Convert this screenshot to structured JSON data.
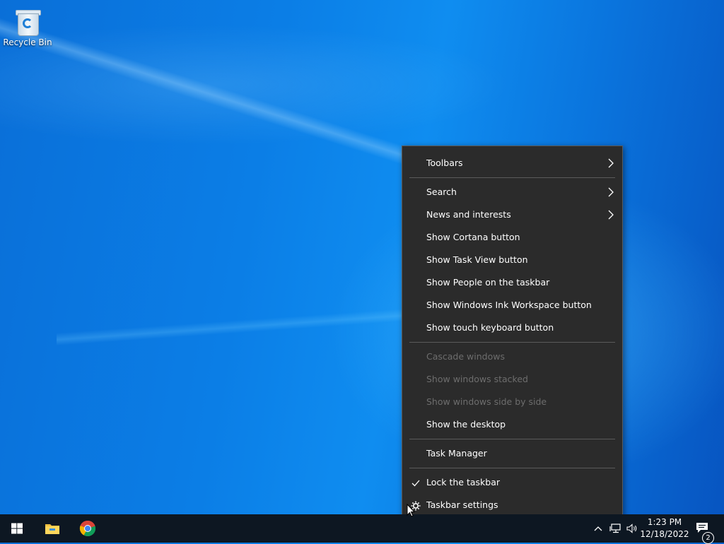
{
  "desktop": {
    "icons": [
      {
        "label": "Recycle Bin",
        "icon": "recycle-bin-icon"
      }
    ]
  },
  "context_menu": {
    "items": [
      {
        "label": "Toolbars",
        "submenu": true,
        "enabled": true
      },
      {
        "label": "Search",
        "submenu": true,
        "enabled": true
      },
      {
        "label": "News and interests",
        "submenu": true,
        "enabled": true
      },
      {
        "label": "Show Cortana button",
        "enabled": true
      },
      {
        "label": "Show Task View button",
        "enabled": true
      },
      {
        "label": "Show People on the taskbar",
        "enabled": true
      },
      {
        "label": "Show Windows Ink Workspace button",
        "enabled": true
      },
      {
        "label": "Show touch keyboard button",
        "enabled": true
      },
      {
        "label": "Cascade windows",
        "enabled": false
      },
      {
        "label": "Show windows stacked",
        "enabled": false
      },
      {
        "label": "Show windows side by side",
        "enabled": false
      },
      {
        "label": "Show the desktop",
        "enabled": true
      },
      {
        "label": "Task Manager",
        "enabled": true
      },
      {
        "label": "Lock the taskbar",
        "checked": true,
        "enabled": true
      },
      {
        "label": "Taskbar settings",
        "icon": "gear-icon",
        "enabled": true
      }
    ]
  },
  "taskbar": {
    "pinned": [
      {
        "name": "start-button",
        "icon": "windows-logo-icon"
      },
      {
        "name": "file-explorer",
        "icon": "folder-icon"
      },
      {
        "name": "chrome",
        "icon": "chrome-icon"
      }
    ],
    "tray": {
      "time": "1:23 PM",
      "date": "12/18/2022",
      "notification_count": "2"
    }
  },
  "colors": {
    "menu_bg": "#2b2b2b",
    "taskbar_bg": "#0d1722",
    "disabled_text": "#6d6d6d"
  }
}
